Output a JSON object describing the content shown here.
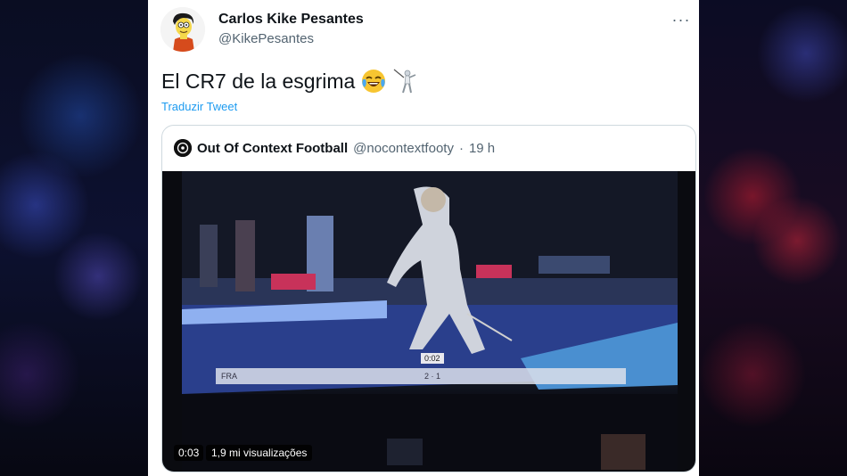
{
  "tweet": {
    "author_name": "Carlos Kike Pesantes",
    "author_handle": "@KikePesantes",
    "text": "El CR7 de la esgrima",
    "translate_label": "Traduzir Tweet",
    "more_label": "···"
  },
  "quoted": {
    "author_name": "Out Of Context Football",
    "author_handle": "@nocontextfooty",
    "separator": "·",
    "time": "19 h",
    "video": {
      "elapsed": "0:03",
      "views": "1,9 mi visualizações",
      "clock": "0:02",
      "score_left": "FRA",
      "score": "2 · 1"
    }
  },
  "colors": {
    "link": "#1d9bf0",
    "text": "#0f1419",
    "secondary": "#536471"
  },
  "icons": {
    "laugh": "face-with-tears-of-joy-icon",
    "fencer": "fencer-icon",
    "more": "more-icon"
  }
}
